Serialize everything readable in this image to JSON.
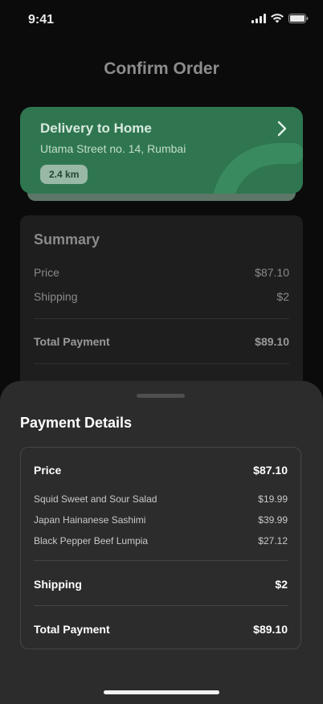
{
  "status_bar": {
    "time": "9:41"
  },
  "screen": {
    "title": "Confirm Order"
  },
  "delivery": {
    "title": "Delivery to Home",
    "address": "Utama Street no. 14, Rumbai",
    "distance": "2.4 km",
    "accent_color": "#2f7650"
  },
  "summary": {
    "title": "Summary",
    "price_label": "Price",
    "price_value": "$87.10",
    "shipping_label": "Shipping",
    "shipping_value": "$2",
    "total_label": "Total Payment",
    "total_value": "$89.10"
  },
  "payment_details": {
    "title": "Payment Details",
    "price_label": "Price",
    "price_value": "$87.10",
    "items": [
      {
        "name": "Squid Sweet and Sour Salad",
        "price": "$19.99"
      },
      {
        "name": "Japan Hainanese Sashimi",
        "price": "$39.99"
      },
      {
        "name": "Black Pepper Beef Lumpia",
        "price": "$27.12"
      }
    ],
    "shipping_label": "Shipping",
    "shipping_value": "$2",
    "total_label": "Total Payment",
    "total_value": "$89.10"
  }
}
